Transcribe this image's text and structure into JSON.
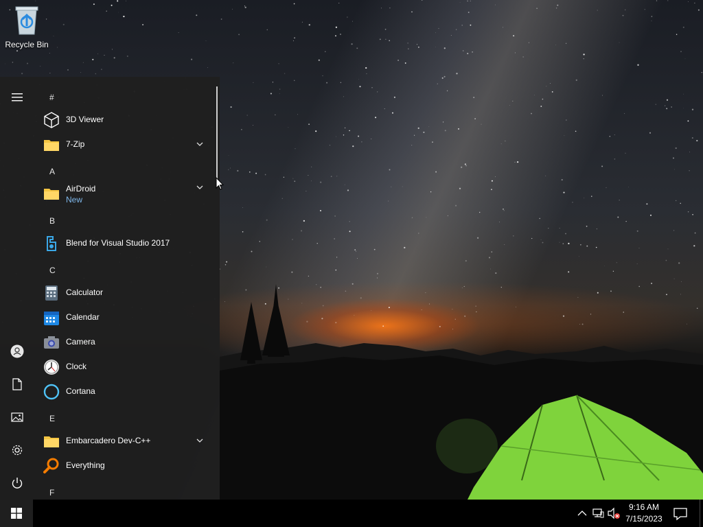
{
  "desktop": {
    "icons": [
      {
        "label": "Recycle Bin",
        "icon": "recycle-bin-icon"
      }
    ]
  },
  "start_menu": {
    "rail": [
      "hamburger-menu-icon",
      "user-icon",
      "documents-icon",
      "pictures-icon",
      "settings-gear-icon",
      "power-icon"
    ],
    "sections": [
      {
        "header": "#",
        "items": [
          {
            "label": "3D Viewer",
            "icon": "3d-viewer-cube-icon"
          },
          {
            "label": "7-Zip",
            "icon": "folder-icon",
            "expandable": true
          }
        ]
      },
      {
        "header": "A",
        "items": [
          {
            "label": "AirDroid",
            "sublabel": "New",
            "icon": "folder-icon",
            "expandable": true
          }
        ]
      },
      {
        "header": "B",
        "items": [
          {
            "label": "Blend for Visual Studio 2017",
            "icon": "blend-icon"
          }
        ]
      },
      {
        "header": "C",
        "items": [
          {
            "label": "Calculator",
            "icon": "calculator-icon"
          },
          {
            "label": "Calendar",
            "icon": "calendar-icon"
          },
          {
            "label": "Camera",
            "icon": "camera-icon"
          },
          {
            "label": "Clock",
            "icon": "clock-icon"
          },
          {
            "label": "Cortana",
            "icon": "cortana-icon"
          }
        ]
      },
      {
        "header": "E",
        "items": [
          {
            "label": "Embarcadero Dev-C++",
            "icon": "folder-icon",
            "expandable": true
          },
          {
            "label": "Everything",
            "icon": "everything-search-icon"
          }
        ]
      },
      {
        "header": "F",
        "items": []
      }
    ]
  },
  "taskbar": {
    "start_button": "windows-logo-icon",
    "tray": [
      "chevron-up-icon",
      "network-icon",
      "volume-muted-icon"
    ],
    "clock": {
      "time": "9:16 AM",
      "date": "7/15/2023"
    },
    "notification_icon": "action-center-icon"
  },
  "colors": {
    "start_menu_bg": "#1f1f1f",
    "accent_link": "#7fb7ea",
    "folder": "#f4c542",
    "tent": "#8ee04a"
  }
}
